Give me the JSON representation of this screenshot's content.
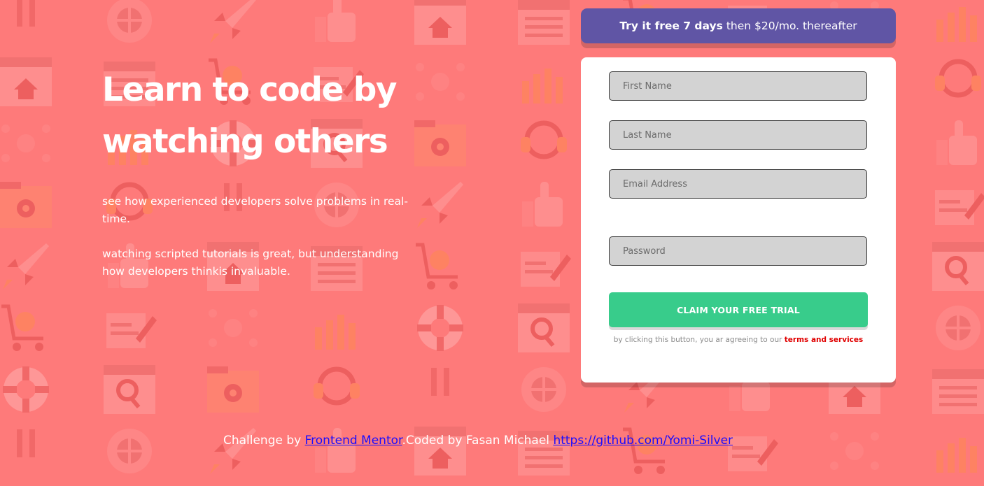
{
  "hero": {
    "title_line1": "Learn to code by",
    "title_line2": "watching others",
    "paragraph1": "see how experienced developers solve problems in real-time.",
    "paragraph2": "watching scripted tutorials is great, but understanding how developers thinkis invaluable."
  },
  "promo": {
    "bold": "Try it free 7 days",
    "rest": "then $20/mo. thereafter"
  },
  "form": {
    "first_name_placeholder": "First Name",
    "last_name_placeholder": "Last Name",
    "email_placeholder": "Email Address",
    "password_placeholder": "Password",
    "submit_label": "CLAIM YOUR FREE TRIAL",
    "terms_text": "by clicking this button, you ar agreeing to our",
    "terms_link": "terms and services"
  },
  "footer": {
    "prefix": "Challenge by",
    "link1": "Frontend Mentor",
    "middle": ".Coded by Fasan Michael",
    "link2": "https://github.com/Yomi-Silver"
  },
  "colors": {
    "background": "#fe7a7a",
    "promo": "#6055a5",
    "cta": "#38cc8b",
    "terms_link": "#e00000",
    "footer_link": "#1a0dff"
  },
  "icons": [
    "graduation-icon",
    "chart-icon",
    "browser-window-icon",
    "headset-icon",
    "network-icon",
    "thumbs-up-icon",
    "folder-gear-icon",
    "pencil-icon",
    "rocket-icon",
    "magnifier-icon",
    "cart-icon",
    "globe-gear-icon",
    "lifebuoy-icon",
    "calendar-icon"
  ]
}
